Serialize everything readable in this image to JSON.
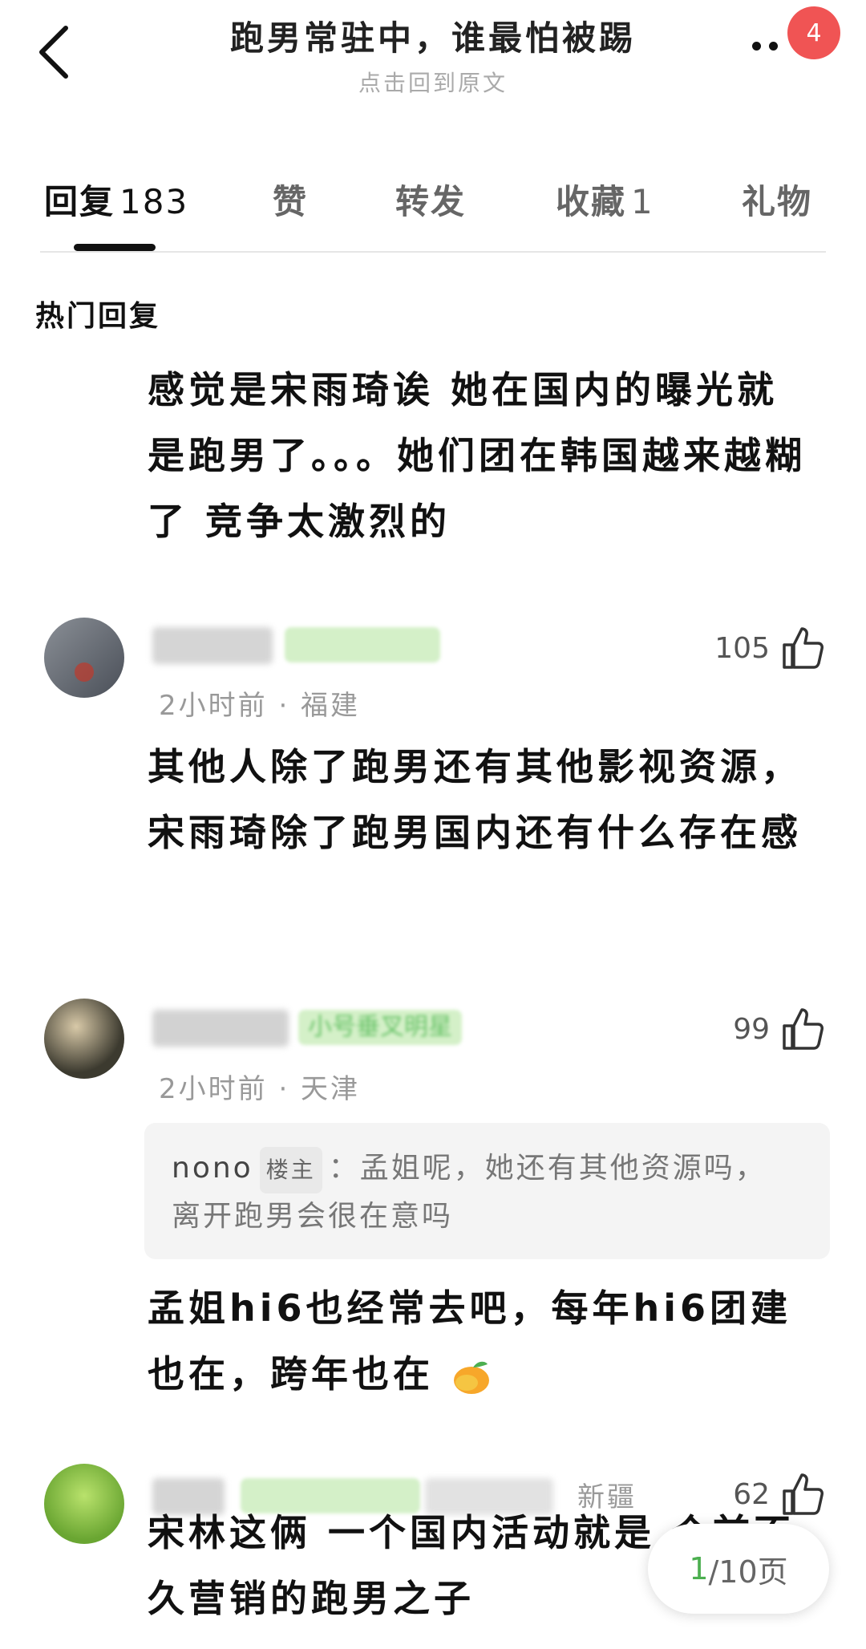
{
  "header": {
    "title": "跑男常驻中，谁最怕被踢",
    "subtitle": "点击回到原文",
    "notification_count": "4"
  },
  "tabs": [
    {
      "label": "回复",
      "count": "183"
    },
    {
      "label": "赞",
      "count": ""
    },
    {
      "label": "转发",
      "count": ""
    },
    {
      "label": "收藏",
      "count": "1"
    },
    {
      "label": "礼物",
      "count": ""
    }
  ],
  "section_title": "热门回复",
  "top_text": "感觉是宋雨琦诶 她在国内的曝光就是跑男了。。。她们团在韩国越来越糊了 竞争太激烈的",
  "comments": [
    {
      "likes": "105",
      "meta": "2小时前 · 福建",
      "text": "其他人除了跑男还有其他影视资源，宋雨琦除了跑男国内还有什么存在感"
    },
    {
      "likes": "99",
      "tag": "小号垂叉明星",
      "meta": "2小时前 · 天津",
      "quote_user": "nono",
      "quote_badge": "楼主",
      "quote_text": "：孟姐呢，她还有其他资源吗，离开跑男会很在意吗",
      "text": "孟姐hi6也经常去吧，每年hi6团建也在，跨年也在"
    },
    {
      "likes": "62",
      "location": "新疆",
      "text": "宋林这俩 一个国内活动就是 个前不久营销的跑男之子"
    }
  ],
  "pager": {
    "current": "1",
    "total": "/10页"
  },
  "colors": {
    "badge": "#f05454",
    "accent_green": "#4caf50"
  },
  "icons": [
    "back-arrow-icon",
    "more-dots-icon",
    "thumb-up-icon",
    "mango-emoji-icon"
  ]
}
